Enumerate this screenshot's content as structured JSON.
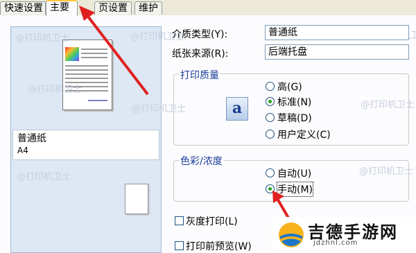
{
  "tabs": [
    {
      "label": "快速设置"
    },
    {
      "label": "主要"
    },
    {
      "label": "页设置"
    },
    {
      "label": "维护"
    }
  ],
  "watermark": "@打印机卫士",
  "preview": {
    "media_name": "普通纸",
    "paper_size": "A4"
  },
  "media_type": {
    "label": "介质类型(Y):",
    "value": "普通纸"
  },
  "paper_source": {
    "label": "纸张来源(R):",
    "value": "后端托盘"
  },
  "print_quality": {
    "title": "打印质量",
    "icon_letter": "a",
    "options": [
      "高(G)",
      "标准(N)",
      "草稿(D)",
      "用户定义(C)"
    ],
    "selected": "标准(N)"
  },
  "color_intensity": {
    "title": "色彩/浓度",
    "options": [
      "自动(U)",
      "手动(M)"
    ],
    "selected": "手动(M)"
  },
  "checkboxes": {
    "grayscale": "灰度打印(L)",
    "preview_before_print": "打印前预览(W)"
  },
  "brand": {
    "name": "吉德手游网",
    "url": "jdzhnl.com"
  },
  "colors": {
    "annotation_arrow": "#e02020",
    "tab_highlight": "#ffc83c",
    "group_title": "#1c3c9a"
  }
}
